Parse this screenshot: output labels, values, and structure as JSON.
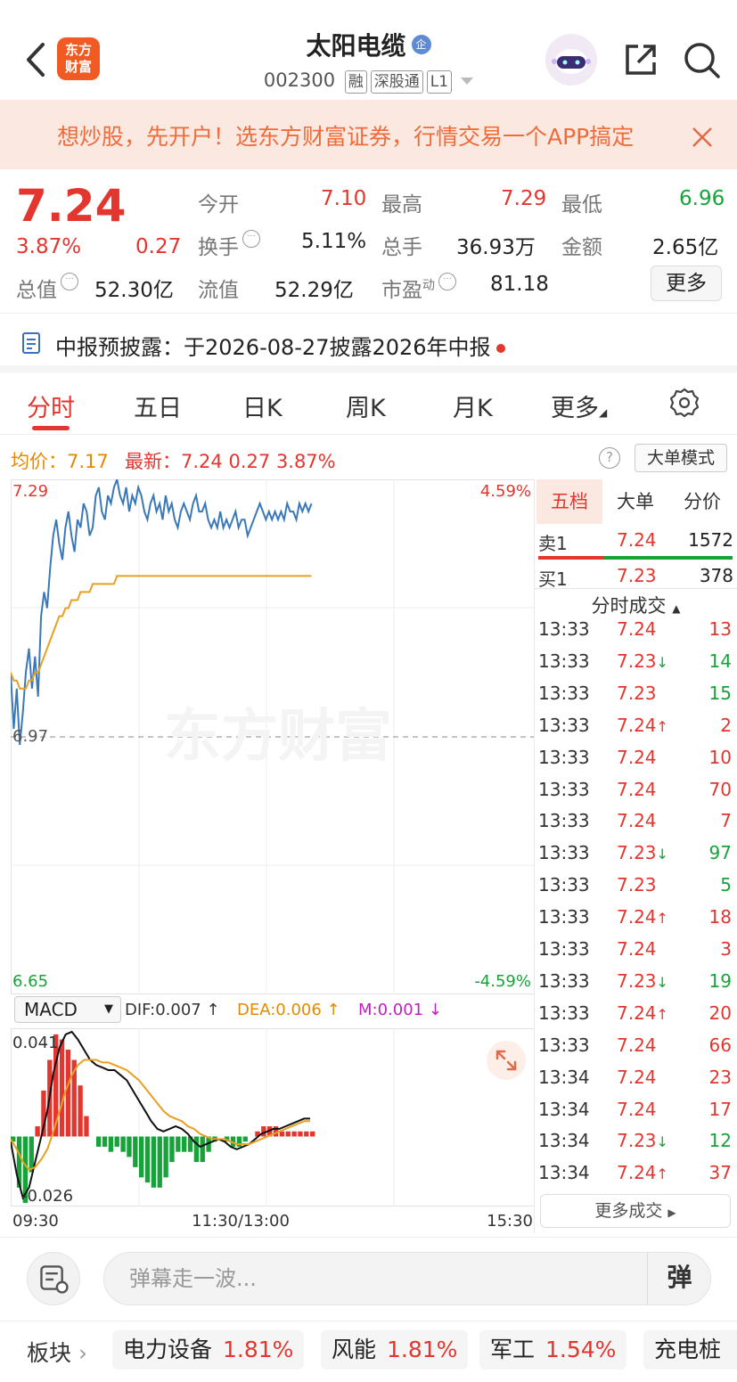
{
  "header": {
    "title": "太阳电缆",
    "badge": "企",
    "code": "002300",
    "tags": [
      "融",
      "深股通",
      "L1"
    ],
    "logo_line1": "东方",
    "logo_line2": "财富"
  },
  "banner": {
    "text": "想炒股，先开户！选东方财富证券，行情交易一个APP搞定"
  },
  "quote": {
    "price": "7.24",
    "change_pct": "3.87%",
    "change": "0.27",
    "open_label": "今开",
    "open": "7.10",
    "high_label": "最高",
    "high": "7.29",
    "low_label": "最低",
    "low": "6.96",
    "turnover_label": "换手",
    "turnover": "5.11%",
    "volume_label": "总手",
    "volume": "36.93万",
    "amount_label": "金额",
    "amount": "2.65亿",
    "mktcap_label": "总值",
    "mktcap": "52.30亿",
    "float_label": "流值",
    "float_cap": "52.29亿",
    "pe_label": "市盈",
    "pe_sup": "动",
    "pe": "81.18",
    "more": "更多"
  },
  "notice": {
    "text": "中报预披露：于2026-08-27披露2026年中报"
  },
  "tabs": [
    "分时",
    "五日",
    "日K",
    "周K",
    "月K",
    "更多"
  ],
  "chart_header": {
    "avg_label": "均价：",
    "avg": "7.17",
    "latest_label": "最新：",
    "latest": "7.24",
    "latest_chg": "0.27",
    "latest_pct": "3.87%",
    "help": "?",
    "big_mode": "大单模式"
  },
  "chart_data": {
    "type": "line",
    "y_top": "7.29",
    "y_mid": "6.97",
    "y_bottom": "6.65",
    "pct_top": "4.59%",
    "pct_bottom": "-4.59%",
    "ylim": [
      6.65,
      7.29
    ],
    "prev_close": 6.97,
    "x_labels": [
      "09:30",
      "11:30/13:00",
      "15:30"
    ],
    "watermark": "东方财富",
    "series": [
      {
        "values": [
          7.05,
          6.98,
          7.03,
          6.96,
          7.0,
          7.05,
          7.08,
          7.03,
          7.07,
          7.02,
          7.12,
          7.15,
          7.13,
          7.18,
          7.22,
          7.24,
          7.21,
          7.19,
          7.23,
          7.25,
          7.22,
          7.2,
          7.24,
          7.23,
          7.26,
          7.25,
          7.22,
          7.23,
          7.27,
          7.28,
          7.25,
          7.24,
          7.27,
          7.26,
          7.28,
          7.29,
          7.27,
          7.26,
          7.28,
          7.25,
          7.27,
          7.26,
          7.28,
          7.27,
          7.25,
          7.24,
          7.26,
          7.27,
          7.25,
          7.26,
          7.24,
          7.27,
          7.25,
          7.26,
          7.24,
          7.23,
          7.25,
          7.26,
          7.25,
          7.24,
          7.26,
          7.27,
          7.25,
          7.25,
          7.26,
          7.24,
          7.23,
          7.24,
          7.23,
          7.25,
          7.23,
          7.24,
          7.23,
          7.24,
          7.25,
          7.23,
          7.24,
          7.24,
          7.22,
          7.23,
          7.24,
          7.25,
          7.26,
          7.25,
          7.24,
          7.25,
          7.24,
          7.25,
          7.24,
          7.25,
          7.24,
          7.26,
          7.25,
          7.25,
          7.24,
          7.26,
          7.25,
          7.26,
          7.25,
          7.26
        ]
      },
      {
        "values": [
          7.05,
          7.04,
          7.04,
          7.03,
          7.03,
          7.03,
          7.04,
          7.04,
          7.05,
          7.05,
          7.06,
          7.07,
          7.08,
          7.09,
          7.1,
          7.11,
          7.12,
          7.12,
          7.13,
          7.13,
          7.14,
          7.14,
          7.14,
          7.15,
          7.15,
          7.15,
          7.15,
          7.16,
          7.16,
          7.16,
          7.16,
          7.16,
          7.16,
          7.16,
          7.16,
          7.17,
          7.17,
          7.17,
          7.17,
          7.17,
          7.17,
          7.17,
          7.17,
          7.17,
          7.17,
          7.17,
          7.17,
          7.17,
          7.17,
          7.17,
          7.17,
          7.17,
          7.17,
          7.17,
          7.17,
          7.17,
          7.17,
          7.17,
          7.17,
          7.17,
          7.17,
          7.17,
          7.17,
          7.17,
          7.17,
          7.17,
          7.17,
          7.17,
          7.17,
          7.17,
          7.17,
          7.17,
          7.17,
          7.17,
          7.17,
          7.17,
          7.17,
          7.17,
          7.17,
          7.17,
          7.17,
          7.17,
          7.17,
          7.17,
          7.17,
          7.17,
          7.17,
          7.17,
          7.17,
          7.17,
          7.17,
          7.17,
          7.17,
          7.17,
          7.17,
          7.17,
          7.17,
          7.17,
          7.17,
          7.17
        ]
      }
    ]
  },
  "macd": {
    "selector": "MACD",
    "dif": "DIF:0.007 ↑",
    "dea": "DEA:0.006 ↑",
    "m": "M:0.001 ↓",
    "y_top": "0.041",
    "y_bottom": "-0.026",
    "ylim": [
      -0.026,
      0.041
    ],
    "dif_values": [
      -0.002,
      -0.015,
      -0.024,
      -0.02,
      -0.01,
      0.0,
      0.01,
      0.025,
      0.035,
      0.04,
      0.041,
      0.038,
      0.034,
      0.03,
      0.028,
      0.027,
      0.026,
      0.026,
      0.024,
      0.022,
      0.018,
      0.014,
      0.01,
      0.006,
      0.003,
      0.002,
      0.003,
      0.004,
      0.003,
      0.001,
      -0.002,
      -0.004,
      -0.003,
      -0.002,
      -0.001,
      -0.002,
      -0.004,
      -0.005,
      -0.004,
      -0.003,
      -0.001,
      0.001,
      0.002,
      0.003,
      0.003,
      0.004,
      0.005,
      0.006,
      0.007,
      0.007
    ],
    "dea_values": [
      -0.001,
      -0.005,
      -0.01,
      -0.013,
      -0.012,
      -0.009,
      -0.005,
      0.002,
      0.01,
      0.018,
      0.024,
      0.028,
      0.03,
      0.03,
      0.03,
      0.029,
      0.029,
      0.028,
      0.027,
      0.026,
      0.024,
      0.022,
      0.019,
      0.016,
      0.013,
      0.01,
      0.008,
      0.007,
      0.006,
      0.004,
      0.003,
      0.001,
      0.0,
      -0.001,
      -0.001,
      -0.001,
      -0.002,
      -0.003,
      -0.003,
      -0.003,
      -0.002,
      -0.001,
      0.0,
      0.001,
      0.002,
      0.003,
      0.004,
      0.005,
      0.006,
      0.006
    ],
    "hist_values": [
      -0.002,
      -0.02,
      -0.026,
      -0.014,
      0.004,
      0.018,
      0.03,
      0.04,
      0.038,
      0.034,
      0.03,
      0.02,
      0.008,
      0.0,
      -0.004,
      -0.004,
      -0.006,
      -0.004,
      -0.006,
      -0.008,
      -0.012,
      -0.016,
      -0.018,
      -0.02,
      -0.02,
      -0.016,
      -0.01,
      -0.006,
      -0.006,
      -0.006,
      -0.01,
      -0.01,
      -0.006,
      -0.002,
      0.0,
      -0.002,
      -0.004,
      -0.004,
      -0.002,
      0.0,
      0.002,
      0.004,
      0.004,
      0.004,
      0.002,
      0.002,
      0.002,
      0.002,
      0.002,
      0.002
    ]
  },
  "right_panel": {
    "tabs": [
      "五档",
      "大单",
      "分价"
    ],
    "sell1_label": "卖1",
    "sell1_price": "7.24",
    "sell1_vol": "1572",
    "buy1_label": "买1",
    "buy1_price": "7.23",
    "buy1_vol": "378",
    "trade_head": "分时成交",
    "trades": [
      {
        "time": "13:33",
        "price": "7.24",
        "dir": "",
        "vol": "13",
        "vcolor": "red"
      },
      {
        "time": "13:33",
        "price": "7.23",
        "dir": "↓",
        "vol": "14",
        "vcolor": "green"
      },
      {
        "time": "13:33",
        "price": "7.23",
        "dir": "",
        "vol": "15",
        "vcolor": "green"
      },
      {
        "time": "13:33",
        "price": "7.24",
        "dir": "↑",
        "vol": "2",
        "vcolor": "red"
      },
      {
        "time": "13:33",
        "price": "7.24",
        "dir": "",
        "vol": "10",
        "vcolor": "red"
      },
      {
        "time": "13:33",
        "price": "7.24",
        "dir": "",
        "vol": "70",
        "vcolor": "red"
      },
      {
        "time": "13:33",
        "price": "7.24",
        "dir": "",
        "vol": "7",
        "vcolor": "red"
      },
      {
        "time": "13:33",
        "price": "7.23",
        "dir": "↓",
        "vol": "97",
        "vcolor": "green"
      },
      {
        "time": "13:33",
        "price": "7.23",
        "dir": "",
        "vol": "5",
        "vcolor": "green"
      },
      {
        "time": "13:33",
        "price": "7.24",
        "dir": "↑",
        "vol": "18",
        "vcolor": "red"
      },
      {
        "time": "13:33",
        "price": "7.24",
        "dir": "",
        "vol": "3",
        "vcolor": "red"
      },
      {
        "time": "13:33",
        "price": "7.23",
        "dir": "↓",
        "vol": "19",
        "vcolor": "green"
      },
      {
        "time": "13:33",
        "price": "7.24",
        "dir": "↑",
        "vol": "20",
        "vcolor": "red"
      },
      {
        "time": "13:33",
        "price": "7.24",
        "dir": "",
        "vol": "66",
        "vcolor": "red"
      },
      {
        "time": "13:34",
        "price": "7.24",
        "dir": "",
        "vol": "23",
        "vcolor": "red"
      },
      {
        "time": "13:34",
        "price": "7.24",
        "dir": "",
        "vol": "17",
        "vcolor": "red"
      },
      {
        "time": "13:34",
        "price": "7.23",
        "dir": "↓",
        "vol": "12",
        "vcolor": "green"
      },
      {
        "time": "13:34",
        "price": "7.24",
        "dir": "↑",
        "vol": "37",
        "vcolor": "red"
      }
    ],
    "more_trades": "更多成交"
  },
  "danmu": {
    "placeholder": "弹幕走一波...",
    "send": "弹"
  },
  "sectors": {
    "label": "板块",
    "items": [
      {
        "name": "电力设备",
        "pct": "1.81%"
      },
      {
        "name": "风能",
        "pct": "1.81%"
      },
      {
        "name": "军工",
        "pct": "1.54%"
      },
      {
        "name": "充电桩",
        "pct": ""
      }
    ]
  },
  "colors": {
    "up": "#e2362f",
    "down": "#17a33a",
    "price_line": "#3a78b8",
    "avg_line": "#e8a020",
    "accent": "#f15a22"
  }
}
